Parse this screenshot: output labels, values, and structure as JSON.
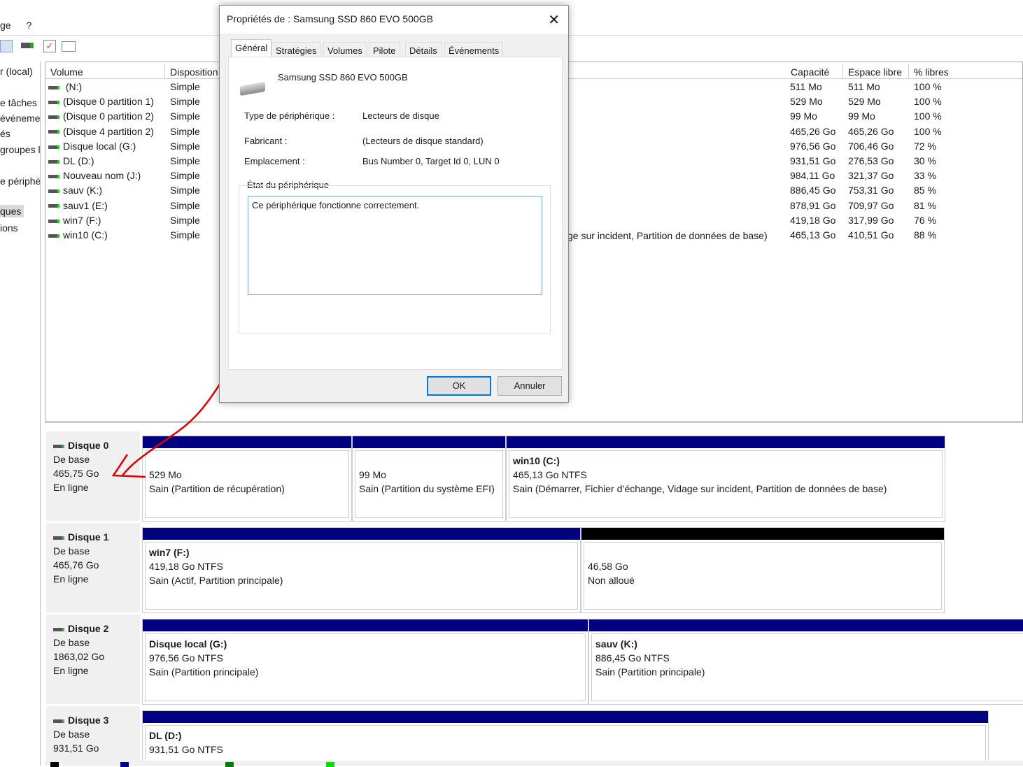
{
  "menu": {
    "items": [
      "ge",
      "?"
    ]
  },
  "nav": {
    "items": [
      "r (local)",
      "e tâches",
      "événeme",
      "és",
      "groupes l",
      "e périphé",
      "ques",
      "ions"
    ]
  },
  "list": {
    "headers": {
      "volume": "Volume",
      "disposition": "Disposition",
      "capacity": "Capacité",
      "free": "Espace libre",
      "pct": "% libres"
    },
    "partial_type": "ge sur incident, Partition de données de base)",
    "rows": [
      {
        "volume": " (N:)",
        "layout": "Simple",
        "capacity": "511 Mo",
        "free": "511 Mo",
        "pct": "100 %"
      },
      {
        "volume": "(Disque 0 partition 1)",
        "layout": "Simple",
        "capacity": "529 Mo",
        "free": "529 Mo",
        "pct": "100 %"
      },
      {
        "volume": "(Disque 0 partition 2)",
        "layout": "Simple",
        "capacity": "99 Mo",
        "free": "99 Mo",
        "pct": "100 %"
      },
      {
        "volume": "(Disque 4 partition 2)",
        "layout": "Simple",
        "capacity": "465,26 Go",
        "free": "465,26 Go",
        "pct": "100 %"
      },
      {
        "volume": "Disque local (G:)",
        "layout": "Simple",
        "capacity": "976,56 Go",
        "free": "706,46 Go",
        "pct": "72 %"
      },
      {
        "volume": "DL (D:)",
        "layout": "Simple",
        "capacity": "931,51 Go",
        "free": "276,53 Go",
        "pct": "30 %"
      },
      {
        "volume": "Nouveau nom (J:)",
        "layout": "Simple",
        "capacity": "984,11 Go",
        "free": "321,37 Go",
        "pct": "33 %"
      },
      {
        "volume": "sauv (K:)",
        "layout": "Simple",
        "capacity": "886,45 Go",
        "free": "753,31 Go",
        "pct": "85 %"
      },
      {
        "volume": "sauv1 (E:)",
        "layout": "Simple",
        "capacity": "878,91 Go",
        "free": "709,97 Go",
        "pct": "81 %"
      },
      {
        "volume": "win7 (F:)",
        "layout": "Simple",
        "capacity": "419,18 Go",
        "free": "317,99 Go",
        "pct": "76 %"
      },
      {
        "volume": "win10 (C:)",
        "layout": "Simple",
        "capacity": "465,13 Go",
        "free": "410,51 Go",
        "pct": "88 %"
      }
    ]
  },
  "disks": [
    {
      "name": "Disque 0",
      "type": "De base",
      "size": "465,75 Go",
      "state": "En ligne",
      "parts": [
        {
          "title": "",
          "size": "529 Mo",
          "status": "Sain (Partition de récupération)"
        },
        {
          "title": "",
          "size": "99 Mo",
          "status": "Sain (Partition du système EFI)"
        },
        {
          "title": "win10  (C:)",
          "size": "465,13 Go NTFS",
          "status": "Sain (Démarrer, Fichier d’échange, Vidage sur incident, Partition de données de base)"
        }
      ]
    },
    {
      "name": "Disque 1",
      "type": "De base",
      "size": "465,76 Go",
      "state": "En ligne",
      "parts": [
        {
          "title": "win7  (F:)",
          "size": "419,18 Go NTFS",
          "status": "Sain (Actif, Partition principale)"
        },
        {
          "title": "",
          "size": "46,58 Go",
          "status": "Non alloué"
        }
      ]
    },
    {
      "name": "Disque 2",
      "type": "De base",
      "size": "1863,02 Go",
      "state": "En ligne",
      "parts": [
        {
          "title": "Disque local  (G:)",
          "size": "976,56 Go NTFS",
          "status": "Sain (Partition principale)"
        },
        {
          "title": "sauv  (K:)",
          "size": "886,45 Go NTFS",
          "status": "Sain (Partition principale)"
        }
      ]
    },
    {
      "name": "Disque 3",
      "type": "De base",
      "size": "931,51 Go",
      "state": "",
      "parts": [
        {
          "title": "DL  (D:)",
          "size": "931,51 Go NTFS",
          "status": ""
        }
      ]
    }
  ],
  "colors": {
    "primary_partition": "#000080",
    "unallocated": "#000000",
    "annotation": "#e00000",
    "legend": [
      "#000000",
      "#000080",
      "#008000",
      "#00e000"
    ]
  },
  "dialog": {
    "title": "Propriétés de : Samsung SSD 860 EVO 500GB",
    "tabs": [
      "Général",
      "Stratégies",
      "Volumes",
      "Pilote",
      "Détails",
      "Événements"
    ],
    "device_name": "Samsung SSD 860 EVO 500GB",
    "type_label": "Type de périphérique :",
    "type_value": "Lecteurs de disque",
    "maker_label": "Fabricant :",
    "maker_value": "(Lecteurs de disque standard)",
    "location_label": "Emplacement :",
    "location_value": "Bus Number 0, Target Id 0, LUN 0",
    "status_group": "État du périphérique",
    "status_text": "Ce périphérique fonctionne correctement.",
    "ok": "OK",
    "cancel": "Annuler"
  }
}
